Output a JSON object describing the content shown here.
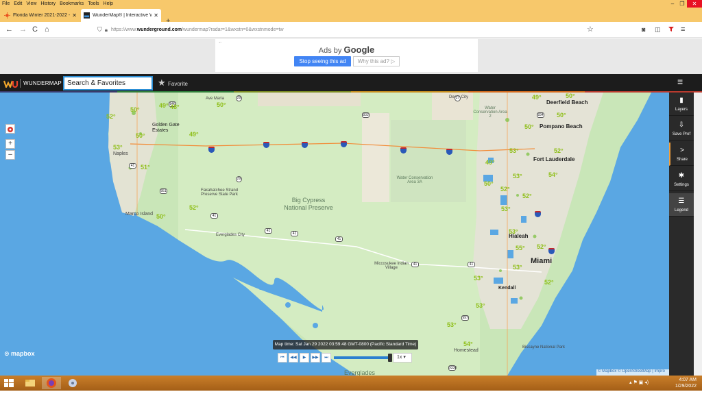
{
  "menubar": {
    "items": [
      "File",
      "Edit",
      "View",
      "History",
      "Bookmarks",
      "Tools",
      "Help"
    ]
  },
  "window_controls": {
    "minimize": "–",
    "restore": "❐",
    "close": "✕"
  },
  "tabs": [
    {
      "title": "Florida Winter 2021-2022 - Page",
      "close": "✕"
    },
    {
      "title": "WunderMap® | Interactive Wea",
      "close": "✕"
    }
  ],
  "newtab": "+",
  "nav": {
    "back": "←",
    "forward": "→",
    "reload": "C",
    "home": "⌂",
    "url_prefix": "https://www.",
    "url_domain": "wunderground.com",
    "url_path": "/wundermap?radar=1&wxstn=0&wxstnmode=tw",
    "bookmark_star": "☆",
    "pocket": "◙",
    "sidebar": "◫",
    "menu": "≡"
  },
  "ad": {
    "back_arrow": "←",
    "ads_by": "Ads by",
    "google": "Google",
    "stop_label": "Stop seeing this ad",
    "why_label": "Why this ad? ▷"
  },
  "header": {
    "brand": "WUNDERMAP",
    "search_placeholder": "Search & Favorites",
    "favorite_label": "Favorite",
    "hamburger": "≡"
  },
  "temp_strip_colors": [
    "#3a3a6a",
    "#2f7d3a",
    "#7a8b22",
    "#c58c1d",
    "#d26a1d",
    "#b83a2e"
  ],
  "map": {
    "zoom_in": "+",
    "zoom_out": "–",
    "mapbox_label": "mapbox",
    "attribution": "© Mapbox © OpenStreetMap | Impro",
    "map_time": "Map time: Sat Jan 29 2022 03:59:48 GMT-0800 (Pacific Standard Time)",
    "player": {
      "first": "⏮",
      "prev": "◀◀",
      "play": "▶",
      "next": "▶▶",
      "last": "⏭",
      "speed": "1x ▾"
    },
    "places": {
      "ave_maria": "Ave Maria",
      "golden_gate": "Golden Gate Estates",
      "naples": "Naples",
      "marco_island": "Marco Island",
      "fakahatchee": "Fakahatchee Strand Preserve State Park",
      "big_cypress": "Big Cypress National Preserve",
      "everglades_city": "Everglades City",
      "wca3a": "Water Conservation Area 3A",
      "wca2": "Water Conservation Area 2",
      "deem_city": "Deem City",
      "miccosukee": "Miccosukee Indian Village",
      "deerfield": "Deerfield Beach",
      "pompano": "Pompano Beach",
      "fort_lauderdale": "Fort Lauderdale",
      "hialeah": "Hialeah",
      "miami": "Miami",
      "kendall": "Kendall",
      "homestead": "Homestead",
      "biscayne": "Biscayne National Park",
      "everglades": "Everglades"
    },
    "temps": [
      "49°",
      "48°",
      "50°",
      "52°",
      "50°",
      "49°",
      "53°",
      "50°",
      "51°",
      "52°",
      "50°",
      "49°",
      "50°",
      "50°",
      "50°",
      "53°",
      "52°",
      "54°",
      "49°",
      "50°",
      "52°",
      "53°",
      "52°",
      "53°",
      "55°",
      "53°",
      "52°",
      "53°",
      "52°",
      "53°",
      "53°",
      "53°",
      "54°"
    ]
  },
  "toolbar": [
    {
      "icon": "▮",
      "label": "Layers"
    },
    {
      "icon": "⇩",
      "label": "Save Pref"
    },
    {
      "icon": ">",
      "label": "Share"
    },
    {
      "icon": "✱",
      "label": "Settings"
    },
    {
      "icon": "☰",
      "label": "Legend"
    }
  ],
  "taskbar": {
    "time": "4:07 AM",
    "date": "1/29/2022",
    "tray_icons": "▴ ⚑ ▣ ◂)"
  }
}
